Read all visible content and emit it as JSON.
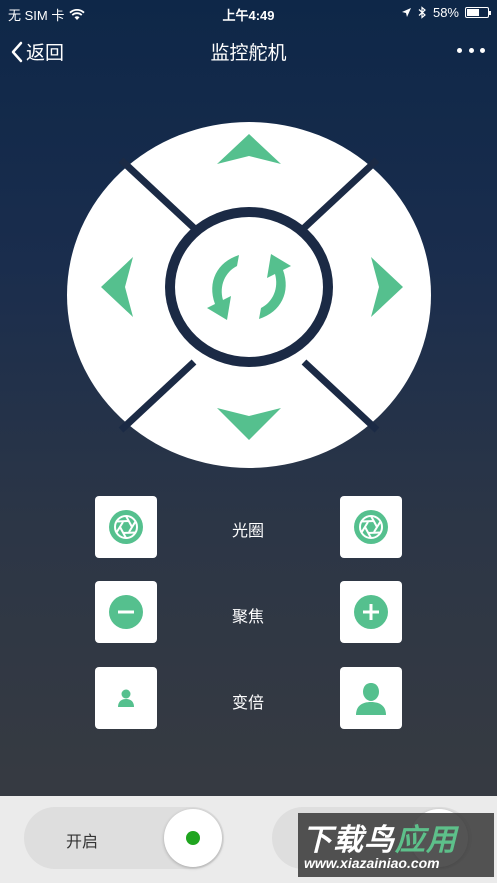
{
  "status_bar": {
    "carrier": "无 SIM 卡",
    "time": "上午4:49",
    "battery_percent": "58%",
    "battery_level": 0.58
  },
  "nav": {
    "back_label": "返回",
    "title": "监控舵机"
  },
  "controls": {
    "aperture_label": "光圈",
    "focus_label": "聚焦",
    "zoom_label": "变倍"
  },
  "bottom": {
    "toggle_label": "开启",
    "toggle_on_color": "#1fa51f"
  },
  "watermark": {
    "main_text_a": "下载鸟",
    "main_text_b": "应用",
    "sub_text": "www.xiazainiao.com"
  },
  "colors": {
    "accent": "#55c08e",
    "panel": "#ffffff"
  }
}
